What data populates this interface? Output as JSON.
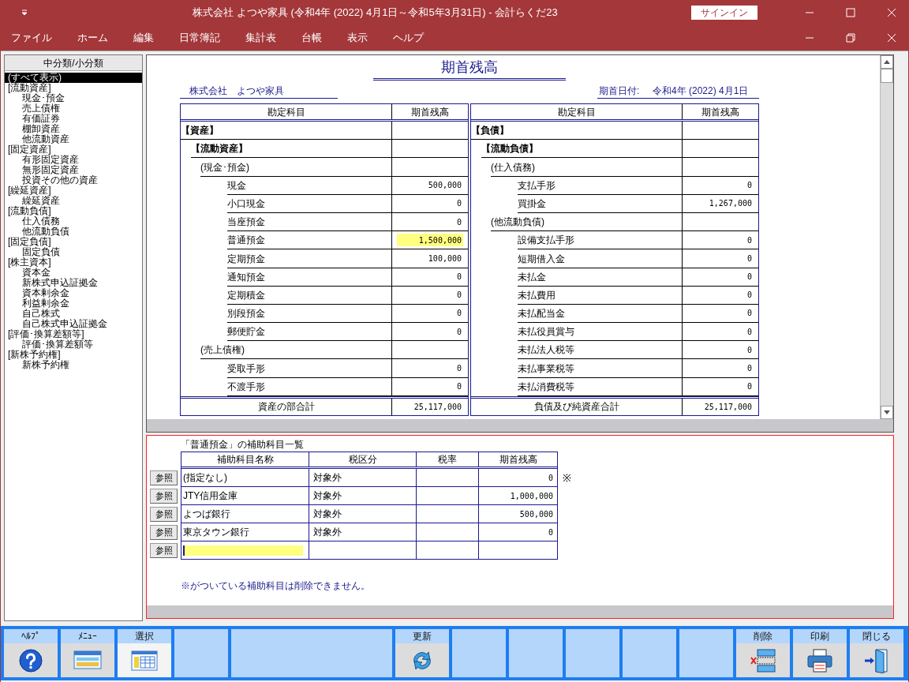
{
  "title_bar": {
    "title": "株式会社 よつや家具 (令和4年 (2022) 4月1日～令和5年3月31日)  -  会計らくだ23",
    "signin_button": "サインイン"
  },
  "menu": [
    "ファイル",
    "ホーム",
    "編集",
    "日常簿記",
    "集計表",
    "台帳",
    "表示",
    "ヘルプ"
  ],
  "sidebar": {
    "header": "中分類/小分類",
    "items": [
      {
        "label": "(すべて表示)",
        "selected": true
      },
      {
        "label": "[流動資産]",
        "selected": false,
        "children": [
          {
            "label": "現金･預金",
            "selected": false
          },
          {
            "label": "売上債権",
            "selected": false
          },
          {
            "label": "有価証券",
            "selected": false
          },
          {
            "label": "棚卸資産",
            "selected": false
          },
          {
            "label": "他流動資産",
            "selected": false
          }
        ]
      },
      {
        "label": "[固定資産]",
        "selected": false,
        "children": [
          {
            "label": "有形固定資産",
            "selected": false
          },
          {
            "label": "無形固定資産",
            "selected": false
          },
          {
            "label": "投資その他の資産",
            "selected": false
          }
        ]
      },
      {
        "label": "[繰延資産]",
        "selected": false,
        "children": [
          {
            "label": "繰延資産",
            "selected": false
          }
        ]
      },
      {
        "label": "[流動負債]",
        "selected": false,
        "children": [
          {
            "label": "仕入債務",
            "selected": false
          },
          {
            "label": "他流動負債",
            "selected": false
          }
        ]
      },
      {
        "label": "[固定負債]",
        "selected": false,
        "children": [
          {
            "label": "固定負債",
            "selected": false
          }
        ]
      },
      {
        "label": "[株主資本]",
        "selected": false,
        "children": [
          {
            "label": "資本金",
            "selected": false
          },
          {
            "label": "新株式申込証拠金",
            "selected": false
          },
          {
            "label": "資本剰余金",
            "selected": false
          },
          {
            "label": "利益剰余金",
            "selected": false
          },
          {
            "label": "自己株式",
            "selected": false
          },
          {
            "label": "自己株式申込証拠金",
            "selected": false
          }
        ]
      },
      {
        "label": "[評価･換算差額等]",
        "selected": false,
        "children": [
          {
            "label": "評価･換算差額等",
            "selected": false
          }
        ]
      },
      {
        "label": "[新株予約権]",
        "selected": false,
        "children": [
          {
            "label": "新株予約権",
            "selected": false
          }
        ]
      }
    ]
  },
  "report": {
    "title": "期首残高",
    "company": "株式会社　よつや家具",
    "date_label": "期首日付:",
    "date_value": "令和4年 (2022) 4月1日",
    "sides": [
      {
        "columns": [
          "勘定科目",
          "期首残高"
        ],
        "rows": [
          {
            "kind": "section",
            "label": "【資産】"
          },
          {
            "kind": "category",
            "label": "【流動資産】"
          },
          {
            "kind": "group",
            "label": "(現金･預金)"
          },
          {
            "kind": "account",
            "label": "現金",
            "value": "500,000",
            "selected": false
          },
          {
            "kind": "account",
            "label": "小口現金",
            "value": "0",
            "selected": false
          },
          {
            "kind": "account",
            "label": "当座預金",
            "value": "0",
            "selected": false
          },
          {
            "kind": "account",
            "label": "普通預金",
            "value": "1,500,000",
            "selected": true
          },
          {
            "kind": "account",
            "label": "定期預金",
            "value": "100,000",
            "selected": false
          },
          {
            "kind": "account",
            "label": "通知預金",
            "value": "0",
            "selected": false
          },
          {
            "kind": "account",
            "label": "定期積金",
            "value": "0",
            "selected": false
          },
          {
            "kind": "account",
            "label": "別段預金",
            "value": "0",
            "selected": false
          },
          {
            "kind": "account",
            "label": "郵便貯金",
            "value": "0",
            "selected": false
          },
          {
            "kind": "group",
            "label": "(売上債権)"
          },
          {
            "kind": "account",
            "label": "受取手形",
            "value": "0",
            "selected": false
          },
          {
            "kind": "account",
            "label": "不渡手形",
            "value": "0",
            "selected": false
          }
        ],
        "total": {
          "label": "資産の部合計",
          "value": "25,117,000"
        }
      },
      {
        "columns": [
          "勘定科目",
          "期首残高"
        ],
        "rows": [
          {
            "kind": "section",
            "label": "【負債】"
          },
          {
            "kind": "category",
            "label": "【流動負債】"
          },
          {
            "kind": "group",
            "label": "(仕入債務)"
          },
          {
            "kind": "account",
            "label": "支払手形",
            "value": "0",
            "selected": false
          },
          {
            "kind": "account",
            "label": "買掛金",
            "value": "1,267,000",
            "selected": false
          },
          {
            "kind": "group",
            "label": "(他流動負債)"
          },
          {
            "kind": "account",
            "label": "設備支払手形",
            "value": "0",
            "selected": false
          },
          {
            "kind": "account",
            "label": "短期借入金",
            "value": "0",
            "selected": false
          },
          {
            "kind": "account",
            "label": "未払金",
            "value": "0",
            "selected": false
          },
          {
            "kind": "account",
            "label": "未払費用",
            "value": "0",
            "selected": false
          },
          {
            "kind": "account",
            "label": "未払配当金",
            "value": "0",
            "selected": false
          },
          {
            "kind": "account",
            "label": "未払役員賞与",
            "value": "0",
            "selected": false
          },
          {
            "kind": "account",
            "label": "未払法人税等",
            "value": "0",
            "selected": false
          },
          {
            "kind": "account",
            "label": "未払事業税等",
            "value": "0",
            "selected": false
          },
          {
            "kind": "account",
            "label": "未払消費税等",
            "value": "0",
            "selected": false
          }
        ],
        "total": {
          "label": "負債及び純資産合計",
          "value": "25,117,000"
        }
      }
    ]
  },
  "sub_accounts": {
    "caption": "「普通預金」の補助科目一覧",
    "columns": [
      "補助科目名称",
      "税区分",
      "税率",
      "期首残高"
    ],
    "rows": [
      {
        "kind": "entry",
        "ref_button": "参照",
        "name": "(指定なし)",
        "tax_category": "対象外",
        "balance": "0",
        "mark": "※"
      },
      {
        "kind": "entry",
        "ref_button": "参照",
        "name": "JTY信用金庫",
        "tax_category": "対象外",
        "balance": "1,000,000"
      },
      {
        "kind": "entry",
        "ref_button": "参照",
        "name": "よつば銀行",
        "tax_category": "対象外",
        "balance": "500,000"
      },
      {
        "kind": "entry",
        "ref_button": "参照",
        "name": "東京タウン銀行",
        "tax_category": "対象外",
        "balance": "0"
      },
      {
        "kind": "input",
        "ref_button": "参照"
      }
    ],
    "note": "※がついている補助科目は削除できません。"
  },
  "toolbar": [
    {
      "kind": "help",
      "label": "ﾍﾙﾌﾟ",
      "selected": false
    },
    {
      "kind": "menu",
      "label": "ﾒﾆｭｰ",
      "selected": false
    },
    {
      "kind": "select",
      "label": "選択",
      "selected": true
    },
    {
      "kind": "blank"
    },
    {
      "kind": "gap"
    },
    {
      "kind": "refresh",
      "label": "更新",
      "selected": false
    },
    {
      "kind": "blank"
    },
    {
      "kind": "blank"
    },
    {
      "kind": "blank"
    },
    {
      "kind": "blank"
    },
    {
      "kind": "blank"
    },
    {
      "kind": "delete",
      "label": "削除",
      "selected": false
    },
    {
      "kind": "print",
      "label": "印刷",
      "selected": false
    },
    {
      "kind": "close",
      "label": "閉じる",
      "selected": false
    }
  ]
}
